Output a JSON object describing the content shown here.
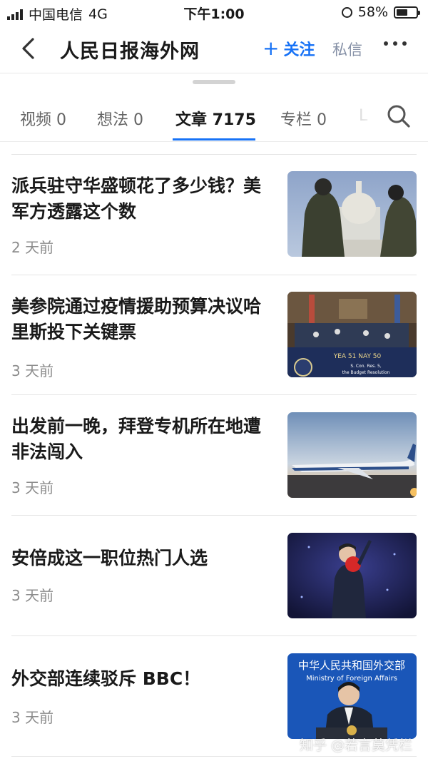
{
  "status_bar": {
    "carrier": "中国电信",
    "network": "4G",
    "time": "下午1:00",
    "battery": "58%"
  },
  "nav": {
    "title": "人民日报海外网",
    "follow_label": "关注",
    "message_label": "私信"
  },
  "tabs": [
    {
      "label": "视频 0"
    },
    {
      "label": "想法 0"
    },
    {
      "label": "文章 7175",
      "active": true
    },
    {
      "label": "专栏 0"
    },
    {
      "label": "L"
    }
  ],
  "articles": [
    {
      "title": "派兵驻守华盛顿花了多少钱？美军方透露这个数",
      "time": "2 天前",
      "thumb_icon": "soldiers-capitol-photo"
    },
    {
      "title": "美参院通过疫情援助预算决议哈里斯投下关键票",
      "time": "3 天前",
      "thumb_icon": "senate-chamber-photo",
      "thumb_caption": [
        "YEA 51   NAY 50",
        "S. Con. Res. 5,",
        "the Budget Resolution"
      ]
    },
    {
      "title": "出发前一晚，拜登专机所在地遭非法闯入",
      "time": "3 天前",
      "thumb_icon": "air-force-one-photo"
    },
    {
      "title": "安倍成这一职位热门人选",
      "time": "3 天前",
      "thumb_icon": "abe-red-ball-photo"
    },
    {
      "title": "外交部连续驳斥 BBC！",
      "time": "3 天前",
      "thumb_icon": "foreign-ministry-spokesman-photo",
      "thumb_caption": [
        "中华人民共和国外交部",
        "Ministry of Foreign Affairs"
      ]
    }
  ],
  "watermark": "知乎 @若言莫凭栏"
}
